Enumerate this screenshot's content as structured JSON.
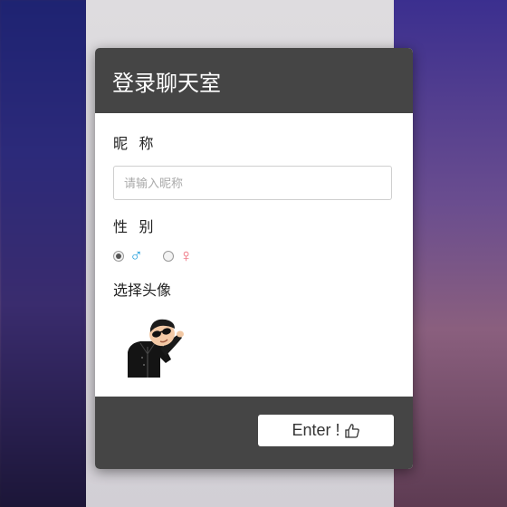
{
  "background": {
    "left_texts": [
      "",
      "",
      ""
    ],
    "bottom_button": ""
  },
  "modal": {
    "title": "登录聊天室",
    "nickname_label": "昵 称",
    "nickname_placeholder": "请输入昵称",
    "nickname_value": "",
    "gender_label": "性 别",
    "gender_options": [
      {
        "symbol": "♂",
        "color": "#1e9ddb",
        "selected": true
      },
      {
        "symbol": "♀",
        "color": "#ee6a78",
        "selected": false
      }
    ],
    "avatar_label": "选择头像",
    "avatar_icon": "avatar-character-icon",
    "enter_button": "Enter !",
    "enter_icon": "thumbs-up-icon"
  },
  "colors": {
    "header_bg": "#454545",
    "footer_bg": "#454545",
    "male": "#1e9ddb",
    "female": "#ee6a78"
  }
}
